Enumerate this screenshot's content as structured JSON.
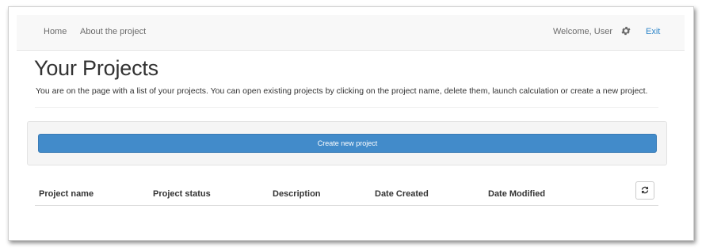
{
  "navbar": {
    "home_label": "Home",
    "about_label": "About the project",
    "welcome_text": "Welcome, User",
    "settings_icon": "gear-icon",
    "exit_label": "Exit"
  },
  "page": {
    "title": "Your Projects",
    "description": "You are on the page with a list of your projects. You can open existing projects by clicking on the project name, delete them, launch calculation or create a new project."
  },
  "actions": {
    "create_label": "Create new project"
  },
  "table": {
    "columns": [
      "Project name",
      "Project status",
      "Description",
      "Date Created",
      "Date Modified"
    ],
    "refresh_icon": "refresh-icon",
    "rows": []
  },
  "colors": {
    "primary": "#428bca",
    "link": "#2f86c9",
    "navbar_bg": "#f8f8f8",
    "well_bg": "#f5f5f5"
  }
}
